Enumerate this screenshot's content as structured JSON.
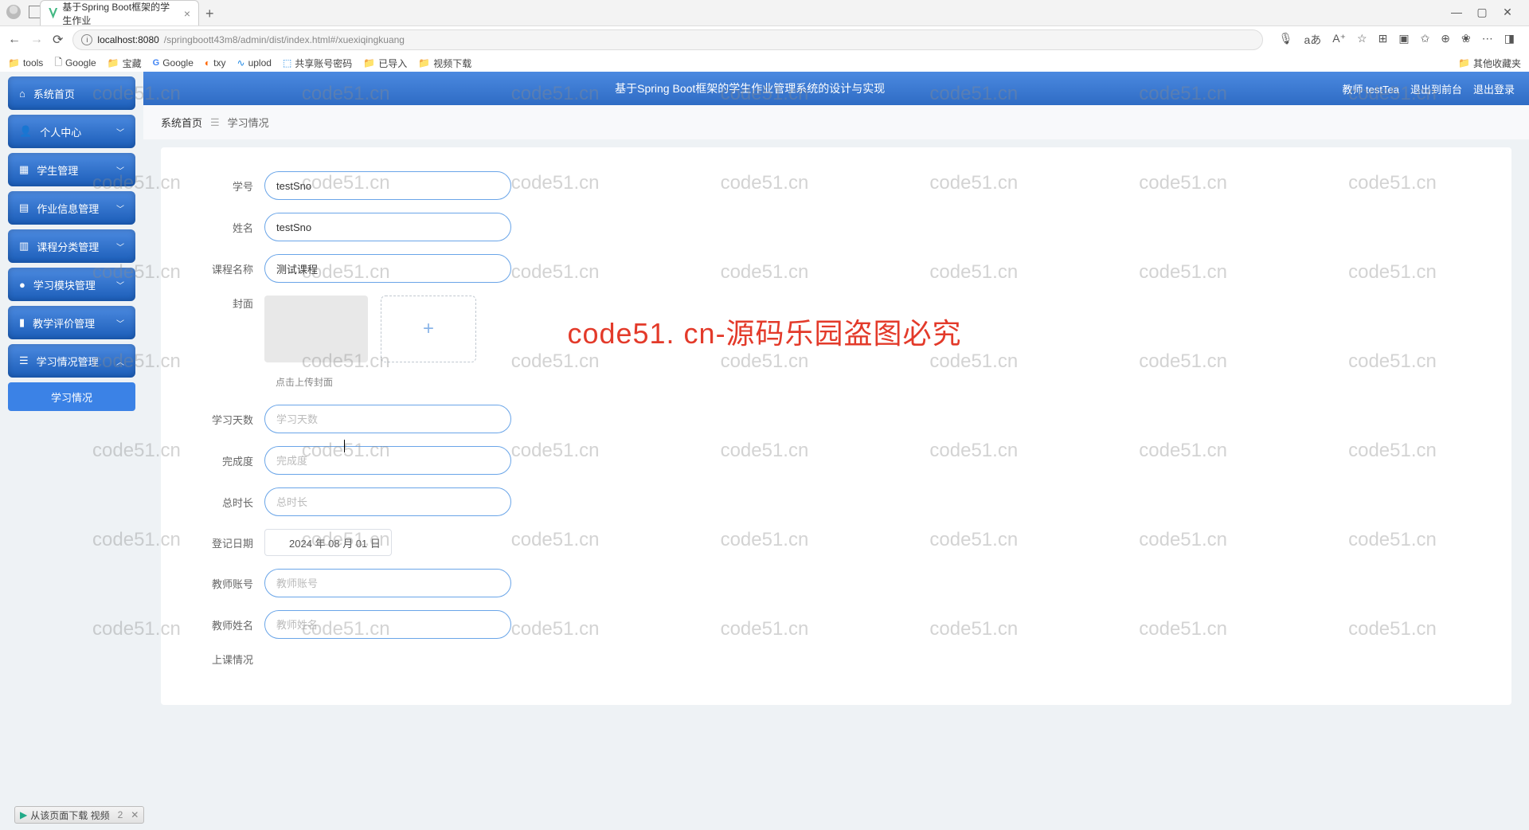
{
  "browser": {
    "tab_title": "基于Spring Boot框架的学生作业",
    "url_host": "localhost:8080",
    "url_path": "/springboott43m8/admin/dist/index.html#/xuexiqingkuang",
    "bookmarks": [
      "tools",
      "Google",
      "宝藏",
      "Google",
      "txy",
      "uplod",
      "共享账号密码",
      "已导入",
      "视频下载"
    ],
    "bookmarks_right": "其他收藏夹"
  },
  "header": {
    "title": "基于Spring Boot框架的学生作业管理系统的设计与实现",
    "user": "教师 testTea",
    "exit_front": "退出到前台",
    "logout": "退出登录"
  },
  "breadcrumb": {
    "home": "系统首页",
    "current": "学习情况"
  },
  "sidebar": {
    "items": [
      {
        "label": "系统首页",
        "icon": "⌂"
      },
      {
        "label": "个人中心",
        "icon": "👤"
      },
      {
        "label": "学生管理",
        "icon": "▦"
      },
      {
        "label": "作业信息管理",
        "icon": "▤"
      },
      {
        "label": "课程分类管理",
        "icon": "▥"
      },
      {
        "label": "学习模块管理",
        "icon": "●"
      },
      {
        "label": "教学评价管理",
        "icon": "▮"
      },
      {
        "label": "学习情况管理",
        "icon": "☰"
      }
    ],
    "active_sub": "学习情况"
  },
  "form": {
    "labels": {
      "sno": "学号",
      "name": "姓名",
      "course": "课程名称",
      "cover": "封面",
      "cover_hint": "点击上传封面",
      "days": "学习天数",
      "progress": "完成度",
      "duration": "总时长",
      "regdate": "登记日期",
      "tacct": "教师账号",
      "tname": "教师姓名",
      "classlog": "上课情况"
    },
    "values": {
      "sno": "testSno",
      "name": "testSno",
      "course": "测试课程",
      "regdate": "2024 年 08 月 01 日"
    },
    "placeholders": {
      "days": "学习天数",
      "progress": "完成度",
      "duration": "总时长",
      "tacct": "教师账号",
      "tname": "教师姓名"
    }
  },
  "watermark": {
    "text": "code51.cn",
    "big": "code51. cn-源码乐园盗图必究"
  },
  "download_bar": {
    "label": "从该页面下载 视频",
    "count": "2"
  }
}
